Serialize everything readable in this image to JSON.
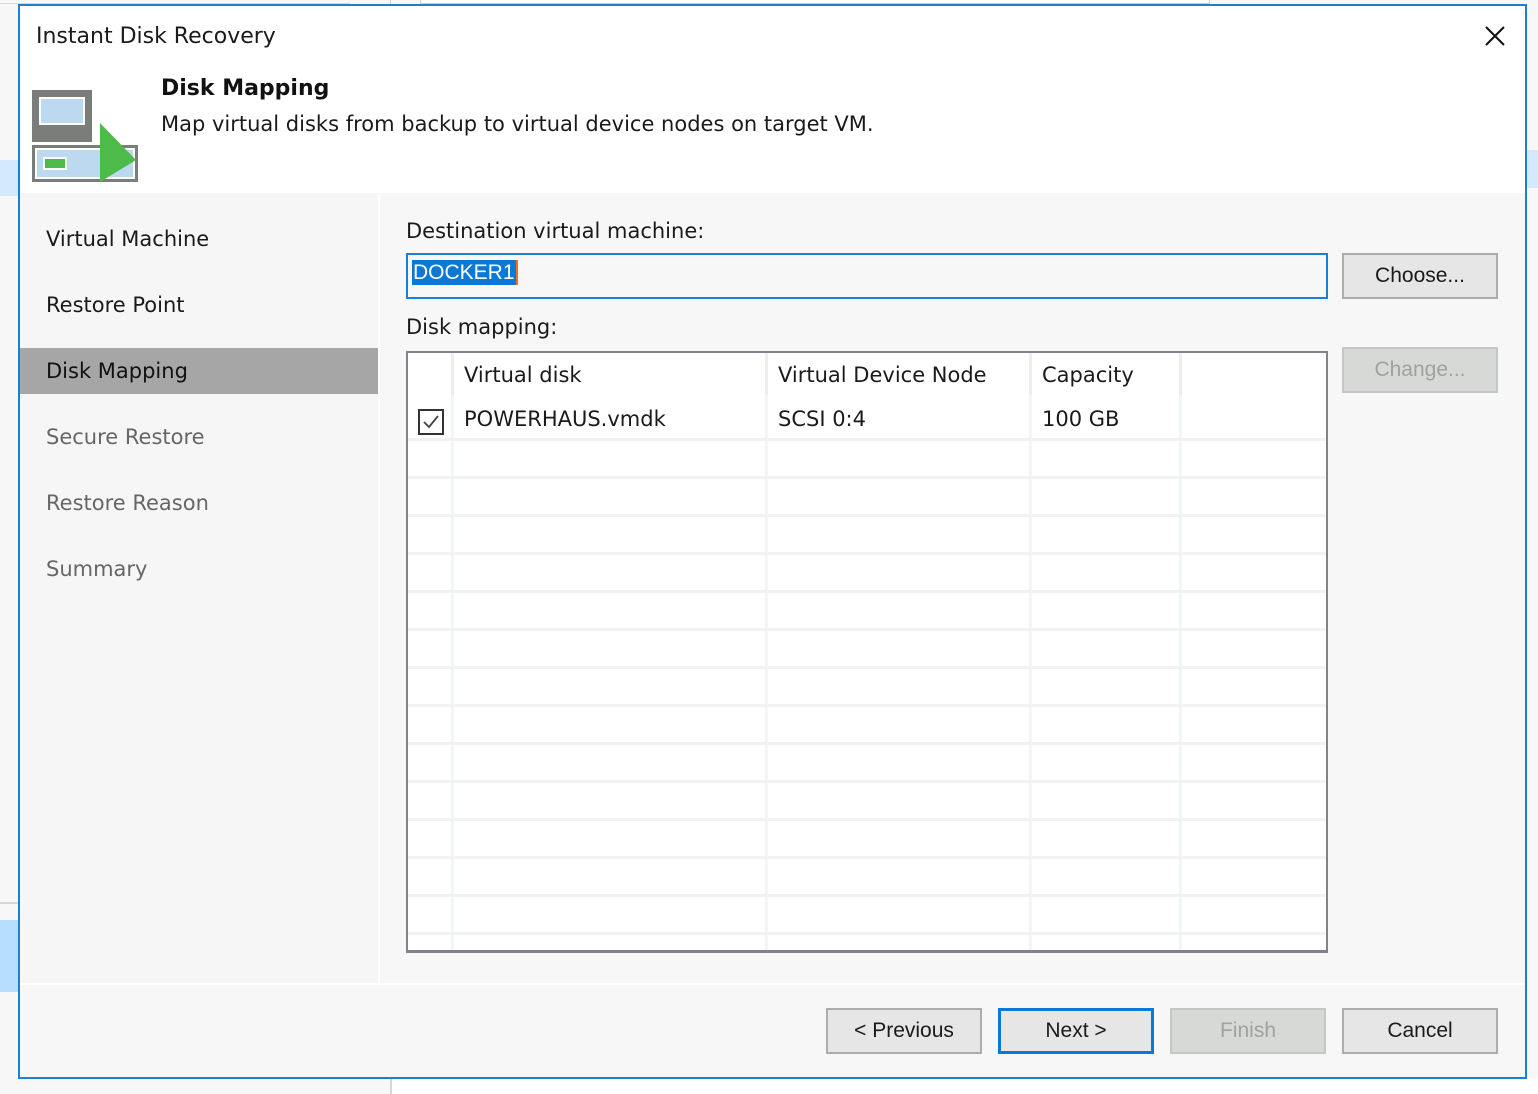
{
  "dialog": {
    "title": "Instant Disk Recovery",
    "close_icon": "close-icon"
  },
  "header": {
    "step_title": "Disk Mapping",
    "step_description": "Map virtual disks from backup to virtual device nodes on target VM.",
    "icon": "restore-vm-icon"
  },
  "sidebar": {
    "items": [
      {
        "label": "Virtual Machine",
        "state": "done"
      },
      {
        "label": "Restore Point",
        "state": "done"
      },
      {
        "label": "Disk Mapping",
        "state": "active"
      },
      {
        "label": "Secure Restore",
        "state": "pending"
      },
      {
        "label": "Restore Reason",
        "state": "pending"
      },
      {
        "label": "Summary",
        "state": "pending"
      }
    ]
  },
  "content": {
    "destination_label": "Destination virtual machine:",
    "destination_value": "DOCKER1",
    "choose_button": "Choose...",
    "disk_mapping_label": "Disk mapping:",
    "change_button": "Change...",
    "table": {
      "columns": [
        "Virtual disk",
        "Virtual Device Node",
        "Capacity"
      ],
      "rows": [
        {
          "checked": true,
          "virtual_disk": "POWERHAUS.vmdk",
          "device_node": "SCSI 0:4",
          "capacity": "100 GB"
        }
      ]
    }
  },
  "footer": {
    "previous_button": "< Previous",
    "next_button": "Next >",
    "finish_button": "Finish",
    "cancel_button": "Cancel"
  },
  "colors": {
    "accent": "#1b7fd4",
    "active_step_bg": "#a6a6a6",
    "icon_green": "#4dbb4a",
    "icon_blue": "#bcd9ef",
    "icon_gray": "#7a7d79"
  }
}
